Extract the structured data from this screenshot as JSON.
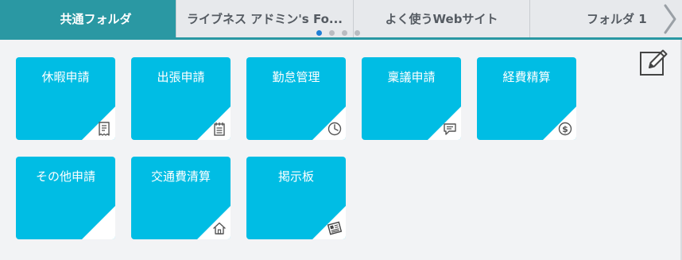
{
  "tabs": [
    {
      "label": "共通フォルダ",
      "active": true
    },
    {
      "label": "ライブネス アドミン's Fo..."
    },
    {
      "label": "よく使うWebサイト"
    },
    {
      "label": "フォルダ 1"
    }
  ],
  "pager": {
    "count": 4,
    "current": 1
  },
  "tiles": [
    {
      "label": "休暇申請",
      "icon": "receipt-icon"
    },
    {
      "label": "出張申請",
      "icon": "notepad-icon"
    },
    {
      "label": "勤怠管理",
      "icon": "clock-icon"
    },
    {
      "label": "稟議申請",
      "icon": "chat-bubble-icon"
    },
    {
      "label": "経費精算",
      "icon": "dollar-coin-icon"
    },
    {
      "label": "その他申請",
      "icon": "blank-icon"
    },
    {
      "label": "交通費清算",
      "icon": "house-icon"
    },
    {
      "label": "掲示板",
      "icon": "newspaper-icon"
    }
  ],
  "colors": {
    "accent": "#2a98a3",
    "tile": "#00bde4",
    "pager_active": "#1f7fd6"
  }
}
